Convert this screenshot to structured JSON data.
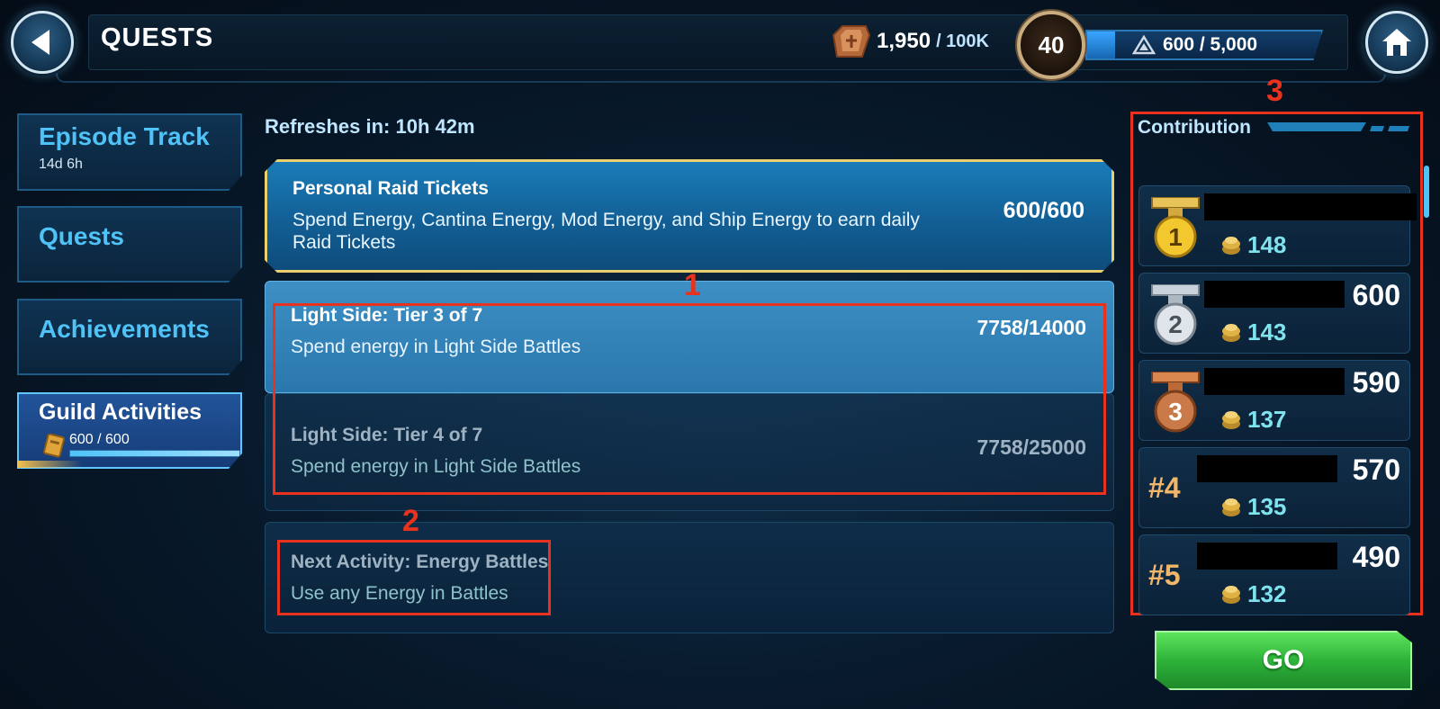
{
  "header": {
    "title": "QUESTS",
    "currency": {
      "amount": "1,950",
      "max": "/ 100K",
      "icon": "raid-crate-icon"
    },
    "level": "40",
    "xp": {
      "text": "600 / 5,000",
      "fill": 0.12,
      "icon": "triangle-icon"
    }
  },
  "nav": {
    "episode_track": {
      "label": "Episode Track",
      "sub": "14d 6h"
    },
    "quests": {
      "label": "Quests"
    },
    "achievements": {
      "label": "Achievements"
    },
    "guild_activities": {
      "label": "Guild Activities",
      "progress_text": "600 / 600",
      "fill": 1.0,
      "icon": "raid-ticket-icon"
    }
  },
  "quests_panel": {
    "refresh_text": "Refreshes in: 10h 42m",
    "raid": {
      "title": "Personal Raid Tickets",
      "desc": "Spend Energy, Cantina Energy, Mod Energy, and Ship Energy to earn daily Raid Tickets",
      "progress": "600/600"
    },
    "tier3": {
      "title": "Light Side: Tier 3 of 7",
      "desc": "Spend energy in Light Side Battles",
      "progress": "7758/14000"
    },
    "tier4": {
      "title": "Light Side: Tier 4 of 7",
      "desc": "Spend energy in Light Side Battles",
      "progress": "7758/25000"
    },
    "next": {
      "title": "Next Activity: Energy Battles",
      "desc": "Use any Energy in Battles"
    }
  },
  "annotations": {
    "one": "1",
    "two": "2",
    "three": "3"
  },
  "contribution": {
    "title": "Contribution",
    "rows": [
      {
        "medal": "gold-medal-icon",
        "medal_num": "1",
        "score": "",
        "tokens": "148"
      },
      {
        "medal": "silver-medal-icon",
        "medal_num": "2",
        "score": "600",
        "tokens": "143"
      },
      {
        "medal": "bronze-medal-icon",
        "medal_num": "3",
        "score": "590",
        "tokens": "137"
      },
      {
        "rank": "#4",
        "score": "570",
        "tokens": "135"
      },
      {
        "rank": "#5",
        "score": "490",
        "tokens": "132"
      }
    ]
  },
  "go_button": {
    "label": "GO"
  },
  "colors": {
    "accent": "#4fc3f7",
    "annotation": "#e8321e",
    "go_green": "#2eb33a",
    "gold_border": "#e9cf6d"
  }
}
